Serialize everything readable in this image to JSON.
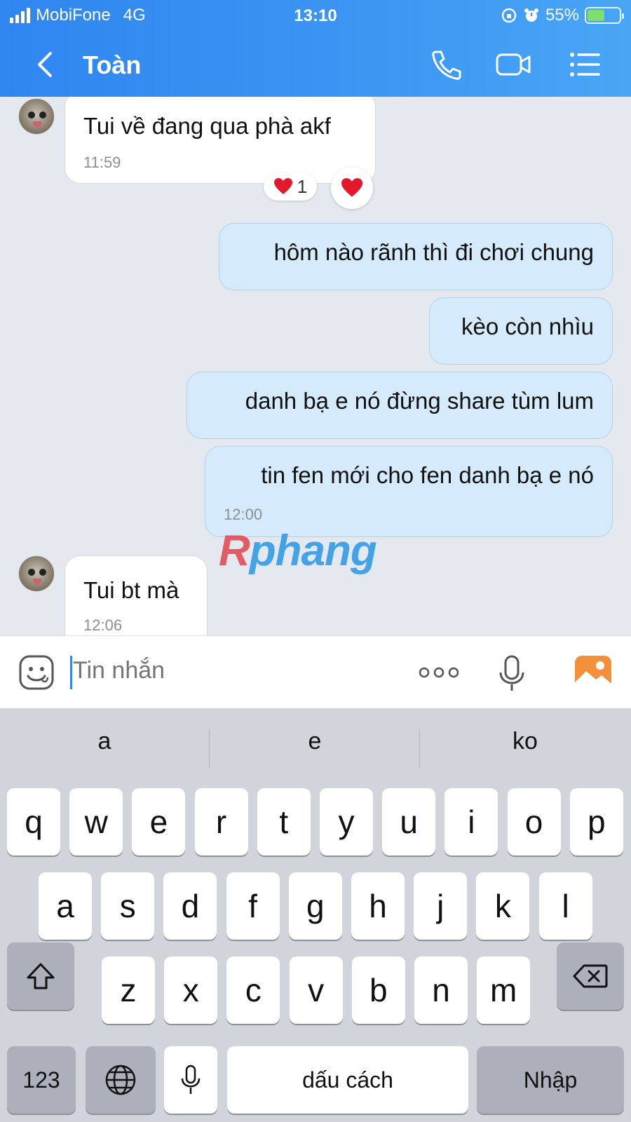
{
  "status_bar": {
    "carrier": "MobiFone",
    "network": "4G",
    "time": "13:10",
    "battery_percent": "55%",
    "battery_level": 0.55
  },
  "header": {
    "back_icon": "chevron-left-icon",
    "contact_name": "Toàn",
    "call_icon": "phone-icon",
    "video_icon": "video-camera-icon",
    "menu_icon": "list-menu-icon"
  },
  "messages": [
    {
      "dir": "in",
      "text": "Tui về đang qua phà akf",
      "time": "11:59",
      "reaction_count": "1"
    },
    {
      "dir": "out",
      "text": "hôm nào rãnh thì đi chơi chung"
    },
    {
      "dir": "out",
      "text": "kèo còn nhìu"
    },
    {
      "dir": "out",
      "text": "danh bạ e nó đừng share tùm lum"
    },
    {
      "dir": "out",
      "text": "tin fen mới cho fen danh bạ e nó",
      "time": "12:00"
    },
    {
      "dir": "in",
      "text": "Tui bt mà",
      "time": "12:06"
    }
  ],
  "watermark": {
    "first": "R",
    "rest": "phang"
  },
  "composer": {
    "placeholder": "Tin nhắn",
    "sticker_icon": "sticker-smile-icon",
    "more_icon": "more-dots-icon",
    "mic_icon": "microphone-icon",
    "photo_icon": "photo-gallery-icon"
  },
  "keyboard": {
    "suggestions": [
      "a",
      "e",
      "ko"
    ],
    "row1": [
      "q",
      "w",
      "e",
      "r",
      "t",
      "y",
      "u",
      "i",
      "o",
      "p"
    ],
    "row2": [
      "a",
      "s",
      "d",
      "f",
      "g",
      "h",
      "j",
      "k",
      "l"
    ],
    "row3": [
      "z",
      "x",
      "c",
      "v",
      "b",
      "n",
      "m"
    ],
    "numbers_label": "123",
    "space_label": "dấu cách",
    "return_label": "Nhập"
  },
  "colors": {
    "header_blue": "#2f86f0",
    "outgoing_bubble": "#d5ebfb",
    "incoming_bubble": "#ffffff",
    "photo_icon_orange": "#f5903a"
  }
}
